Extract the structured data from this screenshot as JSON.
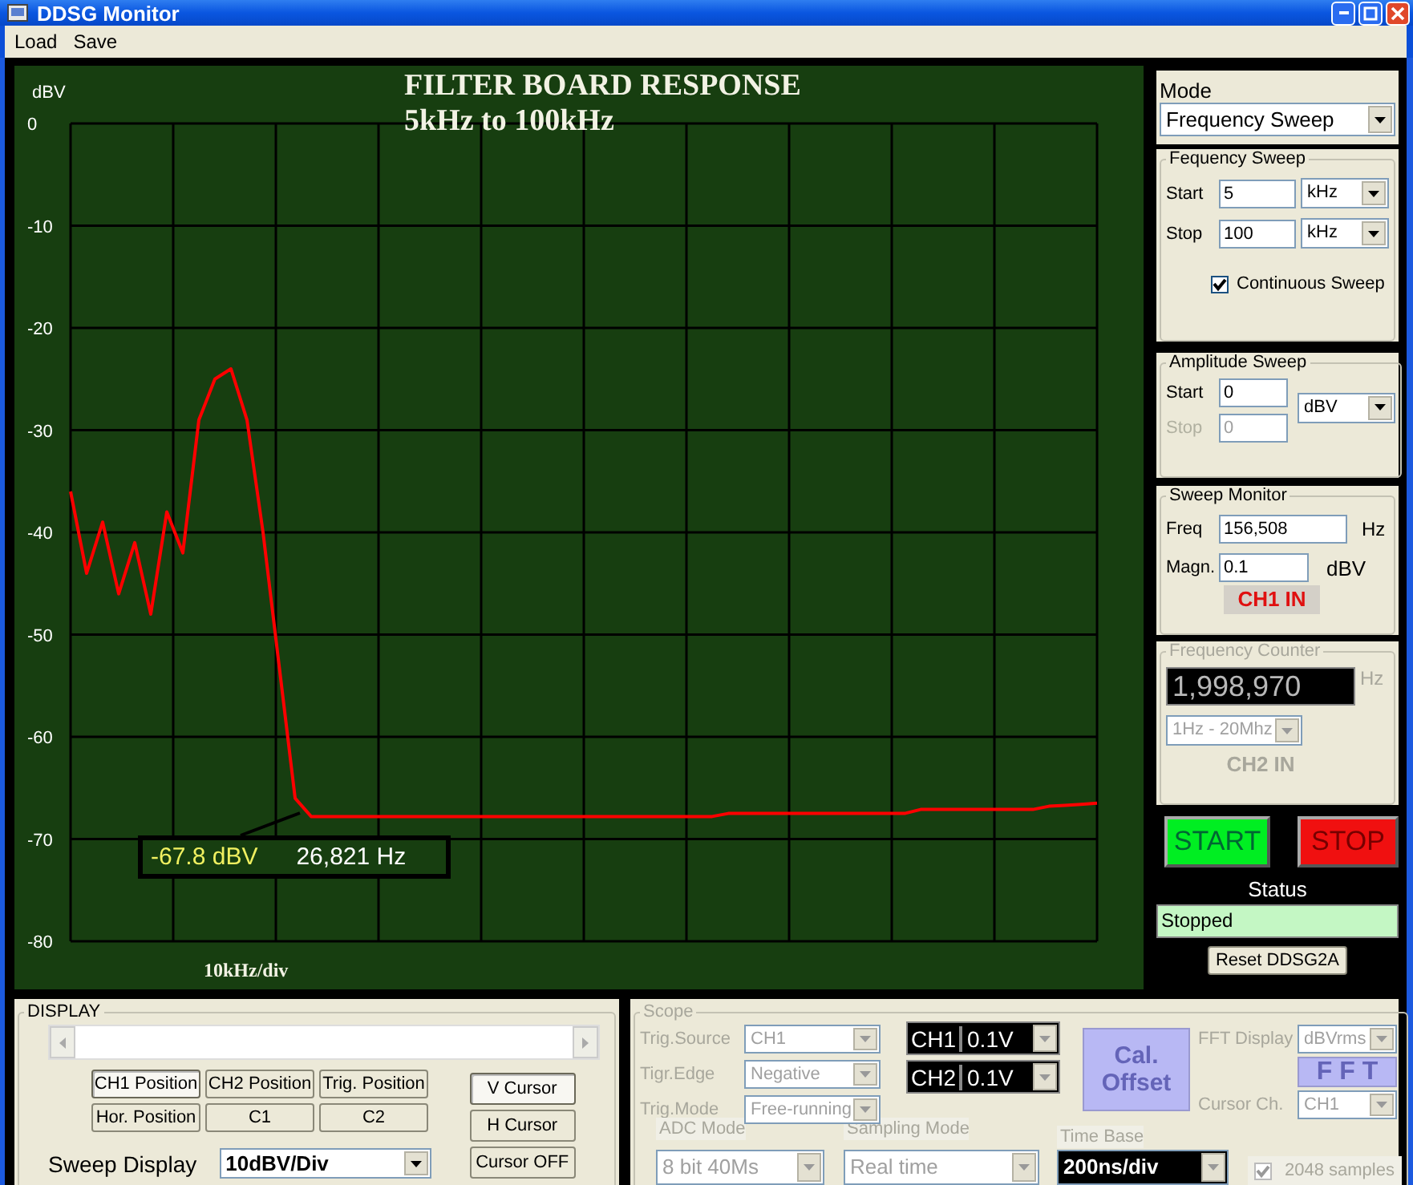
{
  "window": {
    "title": "DDSG Monitor"
  },
  "menu": [
    "Load",
    "Save"
  ],
  "chart": {
    "title": "FILTER BOARD RESPONSE",
    "subtitle": "5kHz to 100kHz",
    "chart_data": {
      "type": "line",
      "grid": true,
      "ylabel": "dBV",
      "xlabel": "10kHz/div",
      "ylim": [
        -80,
        0
      ],
      "yticks": [
        0,
        -10,
        -20,
        -30,
        -40,
        -50,
        -60,
        -70,
        -80
      ],
      "series": [
        {
          "color": "#ff0000",
          "values": [
            -36,
            -44,
            -39,
            -46,
            -41,
            -48,
            -38,
            -42,
            -29,
            -25,
            -24,
            -29,
            -40,
            -53,
            -66,
            -67.8,
            -67.8,
            -67.8,
            -67.8,
            -67.8,
            -67.8,
            -67.8,
            -67.8,
            -67.8,
            -67.8,
            -67.8,
            -67.8,
            -67.8,
            -67.8,
            -67.8,
            -67.8,
            -67.8,
            -67.8,
            -67.8,
            -67.8,
            -67.8,
            -67.8,
            -67.8,
            -67.8,
            -67.8,
            -67.8,
            -67.5,
            -67.5,
            -67.5,
            -67.5,
            -67.5,
            -67.5,
            -67.5,
            -67.5,
            -67.5,
            -67.5,
            -67.5,
            -67.5,
            -67.1,
            -67.1,
            -67.1,
            -67.1,
            -67.1,
            -67.1,
            -67.1,
            -67.1,
            -66.8,
            -66.7,
            -66.6,
            -66.5
          ]
        }
      ]
    },
    "readout": {
      "amplitude": "-67.8 dBV",
      "frequency": "26,821 Hz"
    }
  },
  "mode": {
    "label": "Mode",
    "value": "Frequency Sweep"
  },
  "frequency_sweep": {
    "title": "Fequency Sweep",
    "fields": [
      {
        "label": "Start",
        "value": "5",
        "unit": "kHz"
      },
      {
        "label": "Stop",
        "value": "100",
        "unit": "kHz"
      }
    ],
    "continuous": {
      "label": "Continuous Sweep",
      "checked": true
    }
  },
  "amplitude_sweep": {
    "title": "Amplitude Sweep",
    "fields": [
      {
        "label": "Start",
        "value": "0",
        "disabled": false
      },
      {
        "label": "Stop",
        "value": "0",
        "disabled": true
      }
    ],
    "unit": "dBV"
  },
  "sweep_monitor": {
    "title": "Sweep Monitor",
    "freq_label": "Freq",
    "freq": "156,508",
    "freq_unit": "Hz",
    "magn_label": "Magn.",
    "magn": "0.1",
    "magn_unit": "dBV",
    "channel": "CH1 IN"
  },
  "frequency_counter": {
    "title": "Frequency Counter",
    "disabled": true,
    "reading": "1,998,970",
    "unit": "Hz",
    "range": "1Hz - 20Mhz",
    "channel": "CH2 IN"
  },
  "run_buttons": [
    {
      "label": "START",
      "kind": "start"
    },
    {
      "label": "STOP",
      "kind": "stop"
    }
  ],
  "status": {
    "label": "Status",
    "value": "Stopped"
  },
  "reset_button": "Reset DDSG2A",
  "display": {
    "title": "DISPLAY",
    "position_buttons": [
      {
        "label": "CH1 Position",
        "selected": true
      },
      {
        "label": "CH2 Position",
        "selected": false
      },
      {
        "label": "Trig. Position",
        "selected": false
      },
      {
        "label": "Hor. Position",
        "selected": false
      },
      {
        "label": "C1",
        "selected": false
      },
      {
        "label": "C2",
        "selected": false
      }
    ],
    "cursor_buttons": [
      {
        "label": "V Cursor",
        "selected": true
      },
      {
        "label": "H Cursor",
        "selected": false
      },
      {
        "label": "Cursor OFF",
        "selected": false
      }
    ],
    "sweep_display": {
      "label": "Sweep Display",
      "value": "10dBV/Div"
    }
  },
  "scope": {
    "title": "Scope",
    "disabled": true,
    "trigger": [
      {
        "label": "Trig.Source",
        "value": "CH1"
      },
      {
        "label": "Tigr.Edge",
        "value": "Negative"
      },
      {
        "label": "Trig.Mode",
        "value": "Free-running"
      }
    ],
    "channels": [
      {
        "name": "CH1",
        "value": "0.1V"
      },
      {
        "name": "CH2",
        "value": "0.1V"
      }
    ],
    "cal_button": "Cal. Offset",
    "fft_display": {
      "label": "FFT Display",
      "value": "dBVrms"
    },
    "fft_button": "F F T",
    "cursor_ch": {
      "label": "Cursor Ch.",
      "value": "CH1"
    },
    "modes": [
      {
        "label": "ADC Mode",
        "value": "8 bit 40Ms",
        "kind": "plain"
      },
      {
        "label": "Sampling Mode",
        "value": "Real time",
        "kind": "plain"
      },
      {
        "label": "Time Base",
        "value": "200ns/div",
        "kind": "dark"
      }
    ],
    "samples": {
      "label": "2048 samples",
      "checked": true
    }
  }
}
